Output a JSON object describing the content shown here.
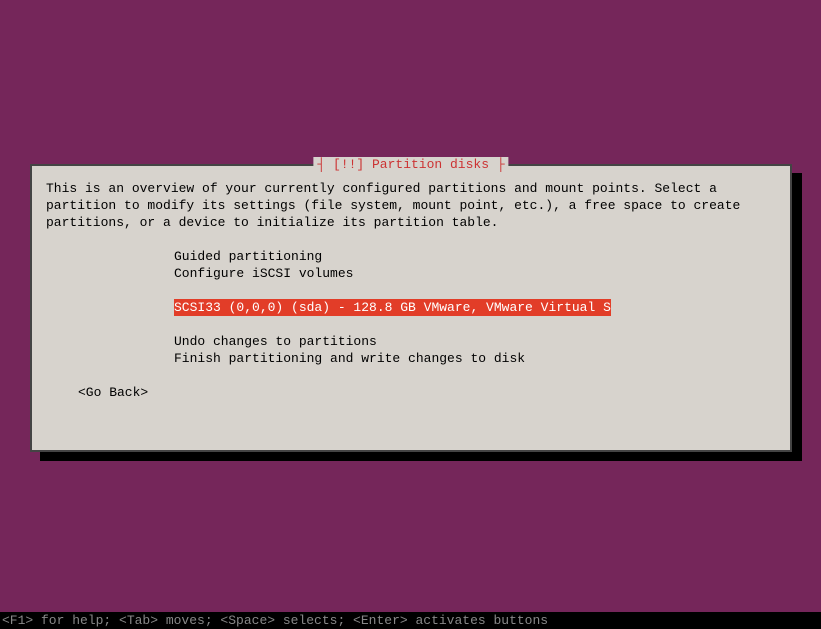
{
  "dialog": {
    "title": "[!!] Partition disks",
    "description": "This is an overview of your currently configured partitions and mount points. Select a\npartition to modify its settings (file system, mount point, etc.), a free space to create\npartitions, or a device to initialize its partition table.",
    "menu": {
      "guided": "Guided partitioning",
      "iscsi": "Configure iSCSI volumes",
      "disk": "SCSI33 (0,0,0) (sda) - 128.8 GB VMware, VMware Virtual S",
      "undo": "Undo changes to partitions",
      "finish": "Finish partitioning and write changes to disk"
    },
    "go_back": "<Go Back>"
  },
  "footer": "<F1> for help; <Tab> moves; <Space> selects; <Enter> activates buttons"
}
